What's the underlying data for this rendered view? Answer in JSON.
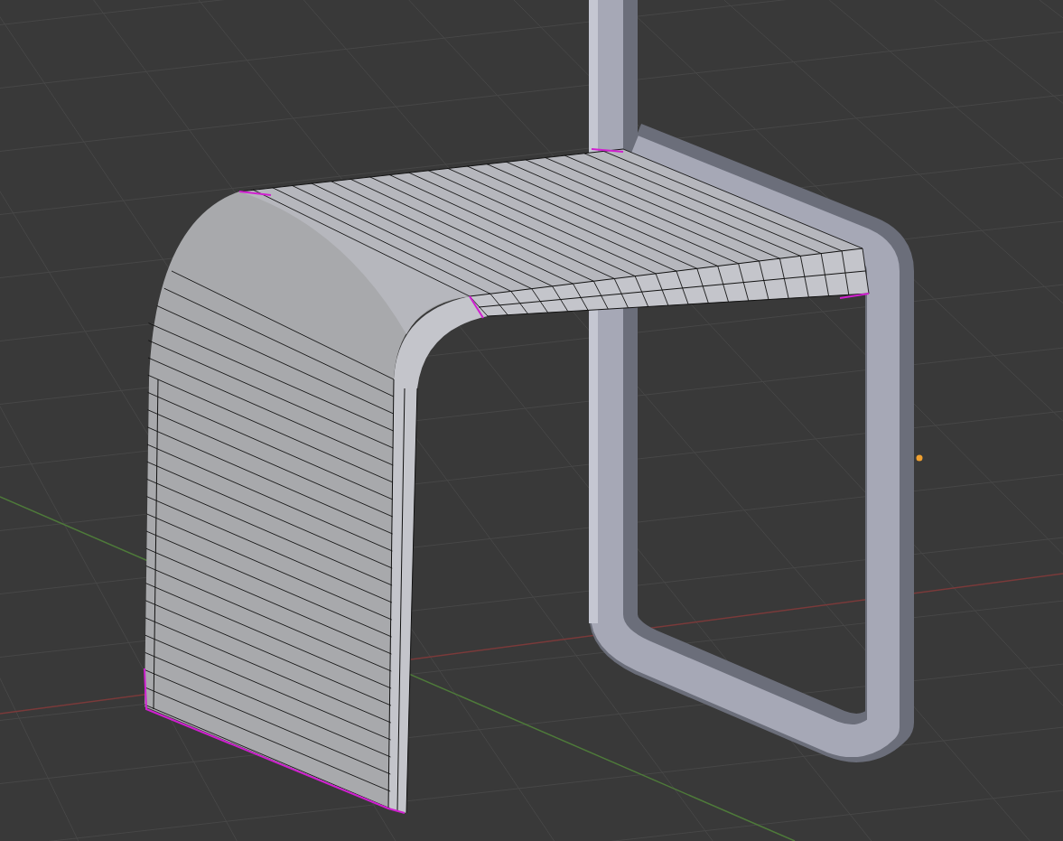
{
  "viewport": {
    "objects": [
      {
        "kind": "frame"
      },
      {
        "kind": "mesh"
      },
      {
        "kind": "origin"
      }
    ]
  }
}
